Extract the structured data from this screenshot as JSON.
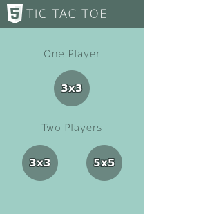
{
  "header": {
    "logo_icon": "html5-icon",
    "title": "TIC TAC TOE"
  },
  "one_player": {
    "label": "One Player",
    "buttons": [
      {
        "label": "3x3"
      }
    ]
  },
  "two_players": {
    "label": "Two Players",
    "buttons": [
      {
        "label": "3x3"
      },
      {
        "label": "5x5"
      }
    ]
  },
  "colors": {
    "background": "#9ecdc4",
    "header": "#536d66",
    "button": "#6b8781",
    "text": "#3d4f4b"
  }
}
